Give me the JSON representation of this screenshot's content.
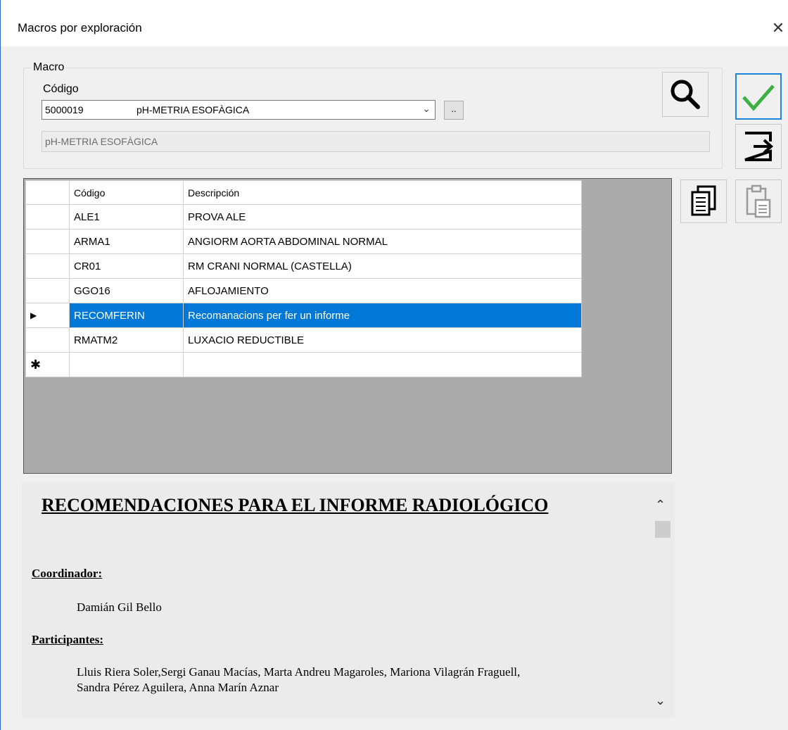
{
  "window": {
    "title": "Macros por exploración",
    "close_glyph": "✕"
  },
  "macro": {
    "group_label": "Macro",
    "code_label": "Código",
    "selected_code": "5000019",
    "selected_desc": "pH-METRIA ESOFÀGICA",
    "dots_label": "..",
    "description_value": "pH-METRIA ESOFÀGICA"
  },
  "buttons": {
    "search_icon": "search-icon",
    "ok_icon": "check-icon",
    "exit_icon": "exit-icon",
    "copy_icon": "copy-icon",
    "paste_icon": "paste-icon"
  },
  "grid": {
    "headers": [
      "Código",
      "Descripción"
    ],
    "rows": [
      {
        "code": "ALE1",
        "desc": "PROVA ALE"
      },
      {
        "code": "ARMA1",
        "desc": "ANGIORM AORTA ABDOMINAL NORMAL"
      },
      {
        "code": "CR01",
        "desc": "RM CRANI NORMAL (CASTELLA)"
      },
      {
        "code": "GGO16",
        "desc": "AFLOJAMIENTO"
      },
      {
        "code": "RECOMFERIN",
        "desc": "Recomanacions per fer un informe"
      },
      {
        "code": "RMATM2",
        "desc": "LUXACIO REDUCTIBLE"
      }
    ],
    "selected_indicator": "▶",
    "new_row_indicator": "✱"
  },
  "document": {
    "title": "RECOMENDACIONES PARA EL INFORME RADIOLÓGICO",
    "coord_heading": "Coordinador:",
    "coord_name": "Damián Gil Bello",
    "part_heading": "Participantes:",
    "part_line1": "Lluis Riera Soler,Sergi Ganau Macías, Marta Andreu Magaroles, Mariona Vilagrán Fraguell,",
    "part_line2": "Sandra Pérez Aguilera, Anna Marín Aznar"
  },
  "colors": {
    "accent": "#0078d7",
    "check_green": "#3cb043"
  }
}
